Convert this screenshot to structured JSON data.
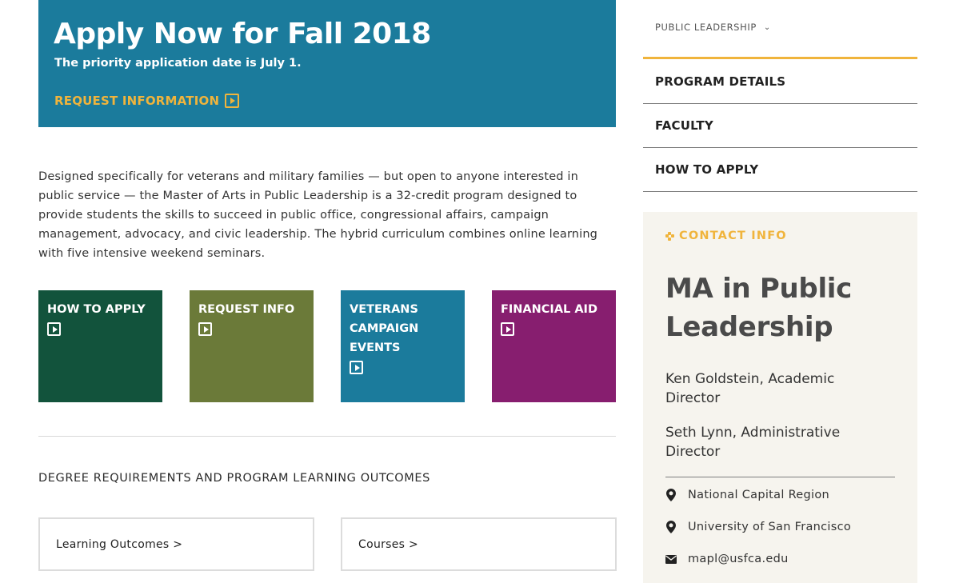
{
  "hero": {
    "title": "Apply Now for Fall 2018",
    "subtitle": "The priority application date is July 1.",
    "link_label": "REQUEST INFORMATION",
    "background": "#1b7b9c",
    "accent": "#f0b43c"
  },
  "intro": "Designed specifically for veterans and military families — but open to anyone interested in public service — the Master of Arts in Public Leadership is a 32-credit program designed to provide students the skills to succeed in public office, congressional affairs, campaign management, advocacy, and civic leadership. The hybrid curriculum combines online learning with five intensive weekend seminars.",
  "tiles": [
    {
      "label": "HOW TO APPLY",
      "color": "#12533c",
      "icon": "play-icon"
    },
    {
      "label": "REQUEST INFO",
      "color": "#6b7a39",
      "icon": "play-icon"
    },
    {
      "label": "VETERANS CAMPAIGN EVENTS",
      "color": "#1b7b9c",
      "icon": "play-icon"
    },
    {
      "label": "FINANCIAL AID",
      "color": "#871e6f",
      "icon": "play-icon"
    }
  ],
  "section": {
    "heading": "DEGREE REQUIREMENTS AND PROGRAM LEARNING OUTCOMES",
    "cards": [
      {
        "label": "Learning Outcomes >"
      },
      {
        "label": "Courses >"
      }
    ]
  },
  "sidebar": {
    "dropdown_label": "PUBLIC LEADERSHIP",
    "dropdown_icon": "chevron-down-icon",
    "nav": [
      {
        "label": "PROGRAM DETAILS"
      },
      {
        "label": "FACULTY"
      },
      {
        "label": "HOW TO APPLY"
      }
    ],
    "contact": {
      "heading": "CONTACT INFO",
      "title": "MA in Public Leadership",
      "people": [
        "Ken Goldstein, Academic Director",
        "Seth Lynn, Administrative Director"
      ],
      "locations": [
        {
          "icon": "map-pin-icon",
          "label": "National Capital Region"
        },
        {
          "icon": "map-pin-icon",
          "label": "University of San Francisco"
        }
      ],
      "email": {
        "icon": "envelope-icon",
        "label": "mapl@usfca.edu"
      },
      "background": "#f6f4ee"
    }
  }
}
